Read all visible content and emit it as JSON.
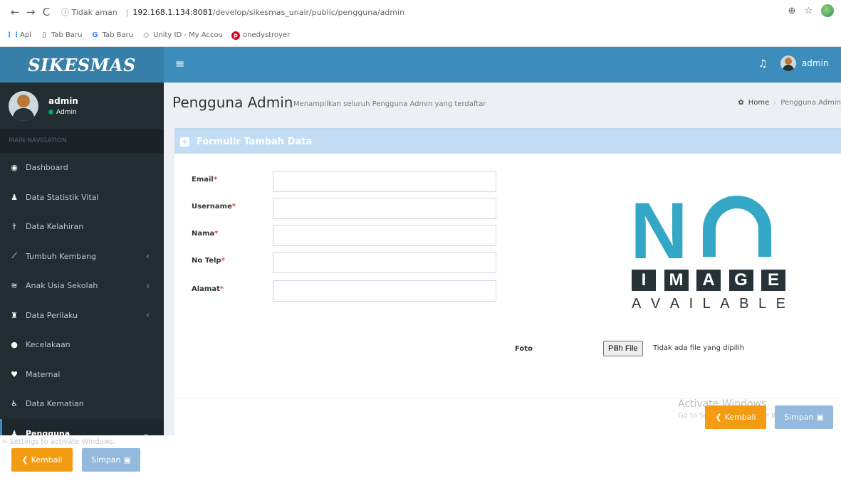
{
  "browser": {
    "back": "←",
    "forward": "→",
    "reload": "C",
    "insecure_label": "ⓘ Tidak aman",
    "url_host": "192.168.1.134:8081",
    "url_path": "/develop/sikesmas_unair/public/pengguna/admin",
    "zoom_icon": "⊕",
    "star_icon": "☆"
  },
  "bookmarks": [
    {
      "icon": "apps-icon",
      "label": "Apl"
    },
    {
      "icon": "page-icon",
      "label": "Tab Baru"
    },
    {
      "icon": "google-icon",
      "label": "Tab Baru"
    },
    {
      "icon": "unity-icon",
      "label": "Unity ID - My Accou"
    },
    {
      "icon": "pinterest-icon",
      "label": "onedystroyer"
    }
  ],
  "app": {
    "logo": "SIKESMAS",
    "top_user": "admin",
    "sidebar_user": {
      "name": "admin",
      "status": "Admin"
    },
    "nav_header": "MAIN NAVIGATION",
    "menu": [
      {
        "icon": "dashboard-icon",
        "glyph": "◉",
        "label": "Dashboard",
        "caret": ""
      },
      {
        "icon": "user-icon",
        "glyph": "♟",
        "label": "Data Statistik Vital",
        "caret": ""
      },
      {
        "icon": "baby-icon",
        "glyph": "†",
        "label": "Data Kelahiran",
        "caret": ""
      },
      {
        "icon": "chart-icon",
        "glyph": "⟋",
        "label": "Tumbuh Kembang",
        "caret": "‹"
      },
      {
        "icon": "graduation-icon",
        "glyph": "≋",
        "label": "Anak Usia Sekolah",
        "caret": "‹"
      },
      {
        "icon": "binoculars-icon",
        "glyph": "♜",
        "label": "Data Perilaku",
        "caret": "‹"
      },
      {
        "icon": "alert-icon",
        "glyph": "●",
        "label": "Kecelakaan",
        "caret": ""
      },
      {
        "icon": "heartbeat-icon",
        "glyph": "♥",
        "label": "Maternal",
        "caret": ""
      },
      {
        "icon": "wheelchair-icon",
        "glyph": "♿",
        "label": "Data Kematian",
        "caret": ""
      },
      {
        "icon": "users-icon",
        "glyph": "♟",
        "label": "Pengguna",
        "caret": "⌄"
      }
    ],
    "page": {
      "title": "Pengguna Admin",
      "subtitle": "Menampilkan seluruh Pengguna Admin yang terdaftar",
      "breadcrumb_home": "Home",
      "breadcrumb_current": "Pengguna Admin"
    },
    "form": {
      "header": "Formulir Tambah Data",
      "fields": [
        {
          "label": "Email",
          "value": ""
        },
        {
          "label": "Username",
          "value": ""
        },
        {
          "label": "Nama",
          "value": ""
        },
        {
          "label": "No Telp",
          "value": ""
        },
        {
          "label": "Alamat",
          "value": ""
        }
      ],
      "required_mark": "*",
      "no_image": {
        "big": "NO",
        "middle": [
          "I",
          "M",
          "A",
          "G",
          "E"
        ],
        "bottom": [
          "A",
          "V",
          "A",
          "I",
          "L",
          "A",
          "B",
          "L",
          "E"
        ]
      },
      "foto_label": "Foto",
      "file_button": "Pilih File",
      "file_status": "Tidak ada file yang dipilih",
      "back_button": "Kembali",
      "save_button": "Simpan"
    },
    "watermark": {
      "title": "Activate Windows",
      "sub": "Go to Settings to activate Windows."
    }
  },
  "overlap": {
    "watermark": "> Settings to activate Windows.",
    "back_button": "Kembali",
    "save_button": "Simpan"
  },
  "colors": {
    "topbar": "#3c8dbc",
    "sidebar": "#222d32",
    "box_header": "#c3ddf4",
    "warning": "#f39c12",
    "primary_disabled": "#93b9dc",
    "no_image_teal": "#34a7c6"
  }
}
